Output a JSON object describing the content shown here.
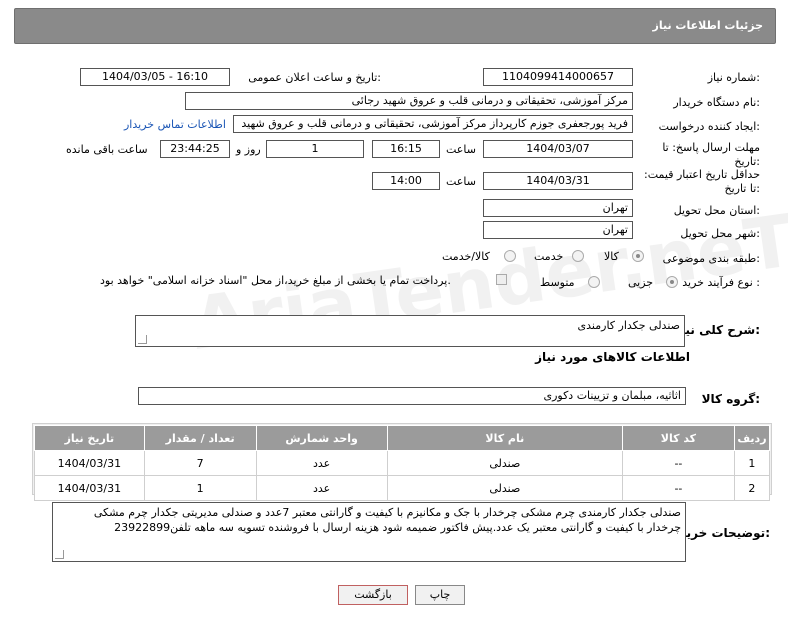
{
  "header": {
    "title": "جزئیات اطلاعات نیاز"
  },
  "labels": {
    "need_number": "شماره نیاز:",
    "announce_datetime": "تاریخ و ساعت اعلان عمومی:",
    "buyer_org": "نام دستگاه خریدار:",
    "requester": "ایجاد کننده درخواست:",
    "contact_link": "اطلاعات تماس خریدار",
    "reply_deadline": "مهلت ارسال پاسخ: تا تاریخ:",
    "time": "ساعت",
    "day_and": "روز و",
    "time_remaining": "ساعت باقی مانده",
    "price_validity": "حداقل تاریخ اعتبار قیمت: تا تاریخ:",
    "province": "استان محل تحویل:",
    "city": "شهر محل تحویل:",
    "category": "طبقه بندی موضوعی:",
    "process_type": "نوع فرآیند خرید :",
    "general_desc": "شرح کلی نیاز:",
    "goods_info": "اطلاعات کالاهای مورد نیاز",
    "goods_group": "گروه کالا:",
    "buyer_notes": "توضیحات خریدار:"
  },
  "fields": {
    "need_number": "1104099414000657",
    "announce_datetime": "1404/03/05 - 16:10",
    "buyer_org": "مرکز آموزشی، تحقیقاتی و درمانی قلب و عروق شهید رجائی",
    "requester": "فرید پورجعفری جوزم کارپرداز  مرکز آموزشی، تحقیقاتی و درمانی قلب و عروق شهید",
    "reply_date": "1404/03/07",
    "reply_time": "16:15",
    "reply_days": "1",
    "reply_remaining": "23:44:25",
    "price_date": "1404/03/31",
    "price_time": "14:00",
    "province": "تهران",
    "city": "تهران",
    "general_desc": "صندلی جکدار کارمندی",
    "goods_group": "اثاثیه، مبلمان و تزیینات دکوری",
    "buyer_notes": "صندلی جکدار کارمندی چرم مشکی چرخدار با جک و مکانیزم با کیفیت و گارانتی معتبر 7عدد و صندلی مدیریتی جکدار چرم مشکی چرخدار با کیفیت و گارانتی معتبر یک عدد.پیش فاکتور ضمیمه شود هزینه ارسال با فروشنده تسویه سه ماهه تلفن23922899"
  },
  "category_options": [
    {
      "label": "کالا",
      "selected": true
    },
    {
      "label": "خدمت",
      "selected": false
    },
    {
      "label": "کالا/خدمت",
      "selected": false
    }
  ],
  "process_options": [
    {
      "label": "جزیی",
      "selected": true
    },
    {
      "label": "متوسط",
      "selected": false
    }
  ],
  "process_note": "پرداخت تمام یا بخشی از مبلغ خرید،از محل \"اسناد خزانه اسلامی\" خواهد بود.",
  "table": {
    "headers": [
      "ردیف",
      "کد کالا",
      "نام کالا",
      "واحد شمارش",
      "تعداد / مقدار",
      "تاریخ نیاز"
    ],
    "rows": [
      [
        "1",
        "--",
        "صندلی",
        "عدد",
        "7",
        "1404/03/31"
      ],
      [
        "2",
        "--",
        "صندلی",
        "عدد",
        "1",
        "1404/03/31"
      ]
    ]
  },
  "buttons": {
    "print": "چاپ",
    "back": "بازگشت"
  },
  "watermark": "AriaTender.neT",
  "colors": {
    "header_bg": "#8a8a8a",
    "table_header_bg": "#9b9b9b",
    "link": "#1a55b5",
    "back_button_border": "#c06060"
  }
}
